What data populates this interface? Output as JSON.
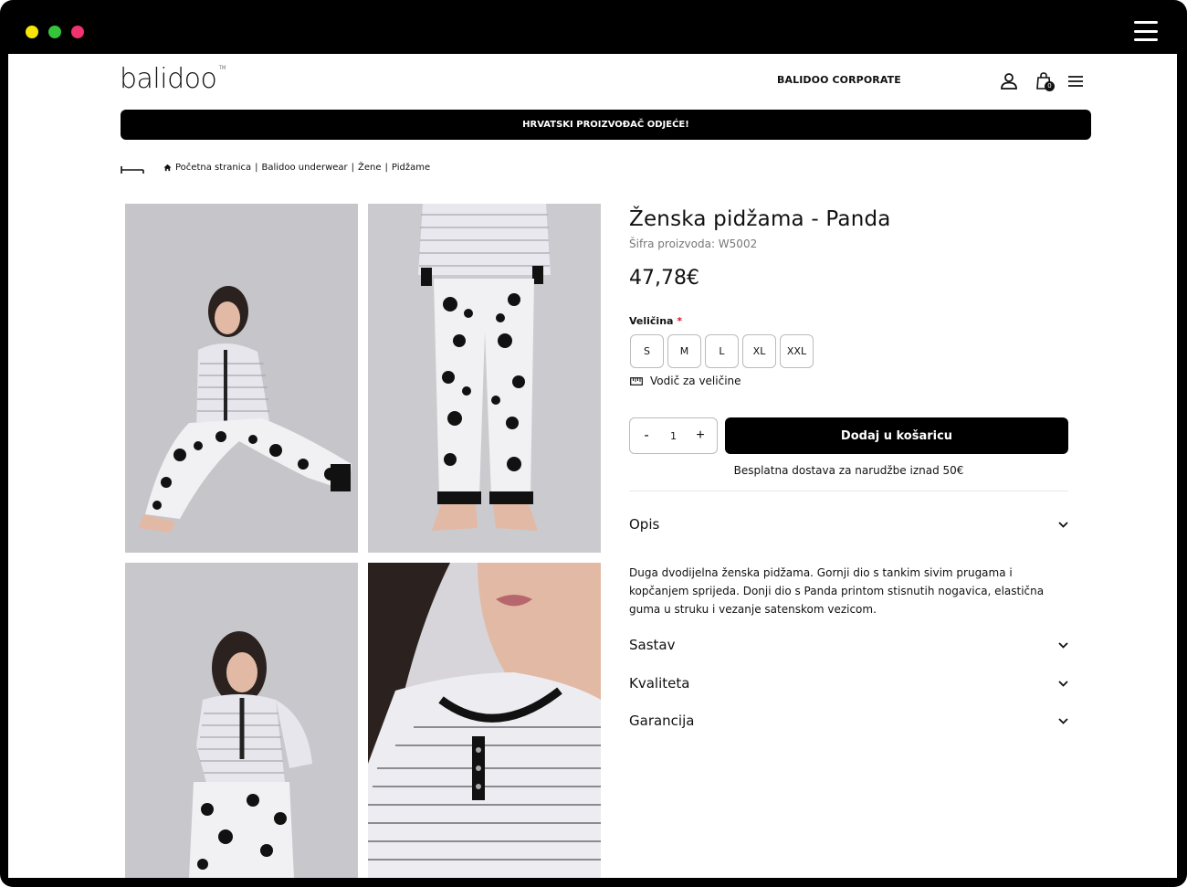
{
  "brand": {
    "logo_text": "balidoo",
    "trademark": "TM"
  },
  "header": {
    "corporate_link": "BALIDOO CORPORATE",
    "cart_count": "0",
    "banner": "HRVATSKI PROIZVOĐAČ ODJEĆE!"
  },
  "breadcrumb": {
    "items": [
      "Početna stranica",
      "Balidoo underwear",
      "Žene",
      "Pidžame"
    ],
    "separator": "|"
  },
  "product": {
    "title": "Ženska pidžama - Panda",
    "sku": "Šifra proizvoda: W5002",
    "price": "47,78€",
    "size_label": "Veličina",
    "required_mark": "*",
    "sizes": [
      "S",
      "M",
      "L",
      "XL",
      "XXL"
    ],
    "size_guide": "Vodič za veličine",
    "quantity": "1",
    "qty_minus": "-",
    "qty_plus": "+",
    "add_to_cart": "Dodaj u košaricu",
    "shipping_note": "Besplatna dostava za narudžbe iznad 50€"
  },
  "accordion": {
    "opis": "Opis",
    "opis_text": "Duga dvodijelna ženska pidžama. Gornji dio s tankim sivim prugama i kopčanjem sprijeda. Donji dio s Panda printom stisnutih nogavica, elastična guma u struku i vezanje satenskom vezicom.",
    "sastav": "Sastav",
    "kvaliteta": "Kvaliteta",
    "garancija": "Garancija"
  },
  "colors": {
    "accent": "#000000",
    "required": "#e0102a",
    "photo_bg": "#c4c3c8"
  },
  "icons": [
    "user-icon",
    "shopping-bag-icon",
    "hamburger-menu-icon",
    "back-arrow-icon",
    "home-icon",
    "ruler-icon",
    "chevron-down-icon"
  ]
}
